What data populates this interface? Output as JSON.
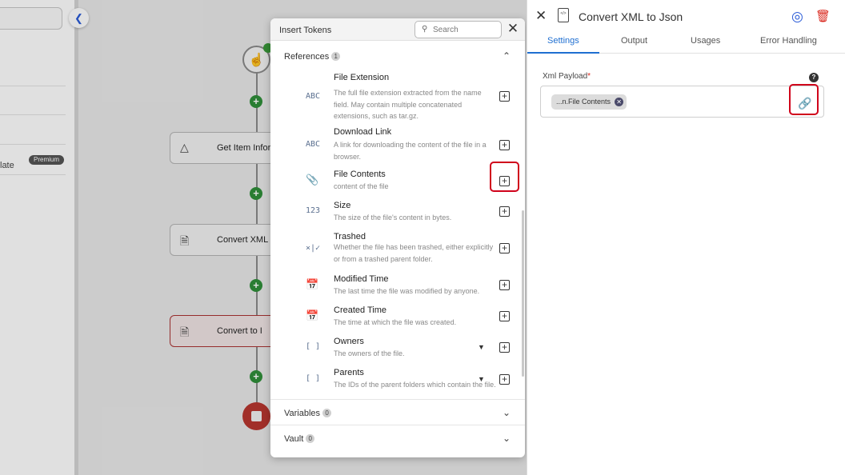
{
  "canvas": {
    "left_item_text": "late",
    "premium_badge": "Premium",
    "steps": [
      {
        "label": "Get Item Infor",
        "icon": "google-drive-icon"
      },
      {
        "label": "Convert XML t",
        "icon": "xml-doc-icon"
      },
      {
        "label": "Convert to I",
        "icon": "doc-icon"
      }
    ]
  },
  "tokens": {
    "title": "Insert Tokens",
    "search_placeholder": "Search",
    "references": {
      "label": "References",
      "count": "1"
    },
    "items": [
      {
        "type": "ABC",
        "name": "File Extension",
        "desc": "The full file extension extracted from the name field. May contain multiple concatenated extensions, such as tar.gz."
      },
      {
        "type": "ABC",
        "name": "Download Link",
        "desc": "A link for downloading the content of the file in a browser."
      },
      {
        "type": "paperclip-icon",
        "name": "File Contents",
        "desc": "content of the file"
      },
      {
        "type": "123",
        "name": "Size",
        "desc": "The size of the file's content in bytes."
      },
      {
        "type": "×|✓",
        "name": "Trashed",
        "desc": "Whether the file has been trashed, either explicitly or from a trashed parent folder."
      },
      {
        "type": "calendar-icon",
        "name": "Modified Time",
        "desc": "The last time the file was modified by anyone."
      },
      {
        "type": "calendar-icon",
        "name": "Created Time",
        "desc": "The time at which the file was created."
      },
      {
        "type": "[ ]",
        "name": "Owners",
        "desc": "The owners of the file."
      },
      {
        "type": "[ ]",
        "name": "Parents",
        "desc": "The IDs of the parent folders which contain the file."
      }
    ],
    "variables": {
      "label": "Variables",
      "count": "0"
    },
    "vault": {
      "label": "Vault",
      "count": "0"
    }
  },
  "panel": {
    "title": "Convert XML to Json",
    "tabs": [
      "Settings",
      "Output",
      "Usages",
      "Error Handling"
    ],
    "active_tab": "Settings",
    "field_label": "Xml Payload",
    "required_mark": "*",
    "chip_text": "...n.File Contents"
  },
  "colors": {
    "accent": "#1f6fd1",
    "highlight": "#d0021b",
    "stop": "#b8362f",
    "add_node": "#2f8f3a"
  }
}
